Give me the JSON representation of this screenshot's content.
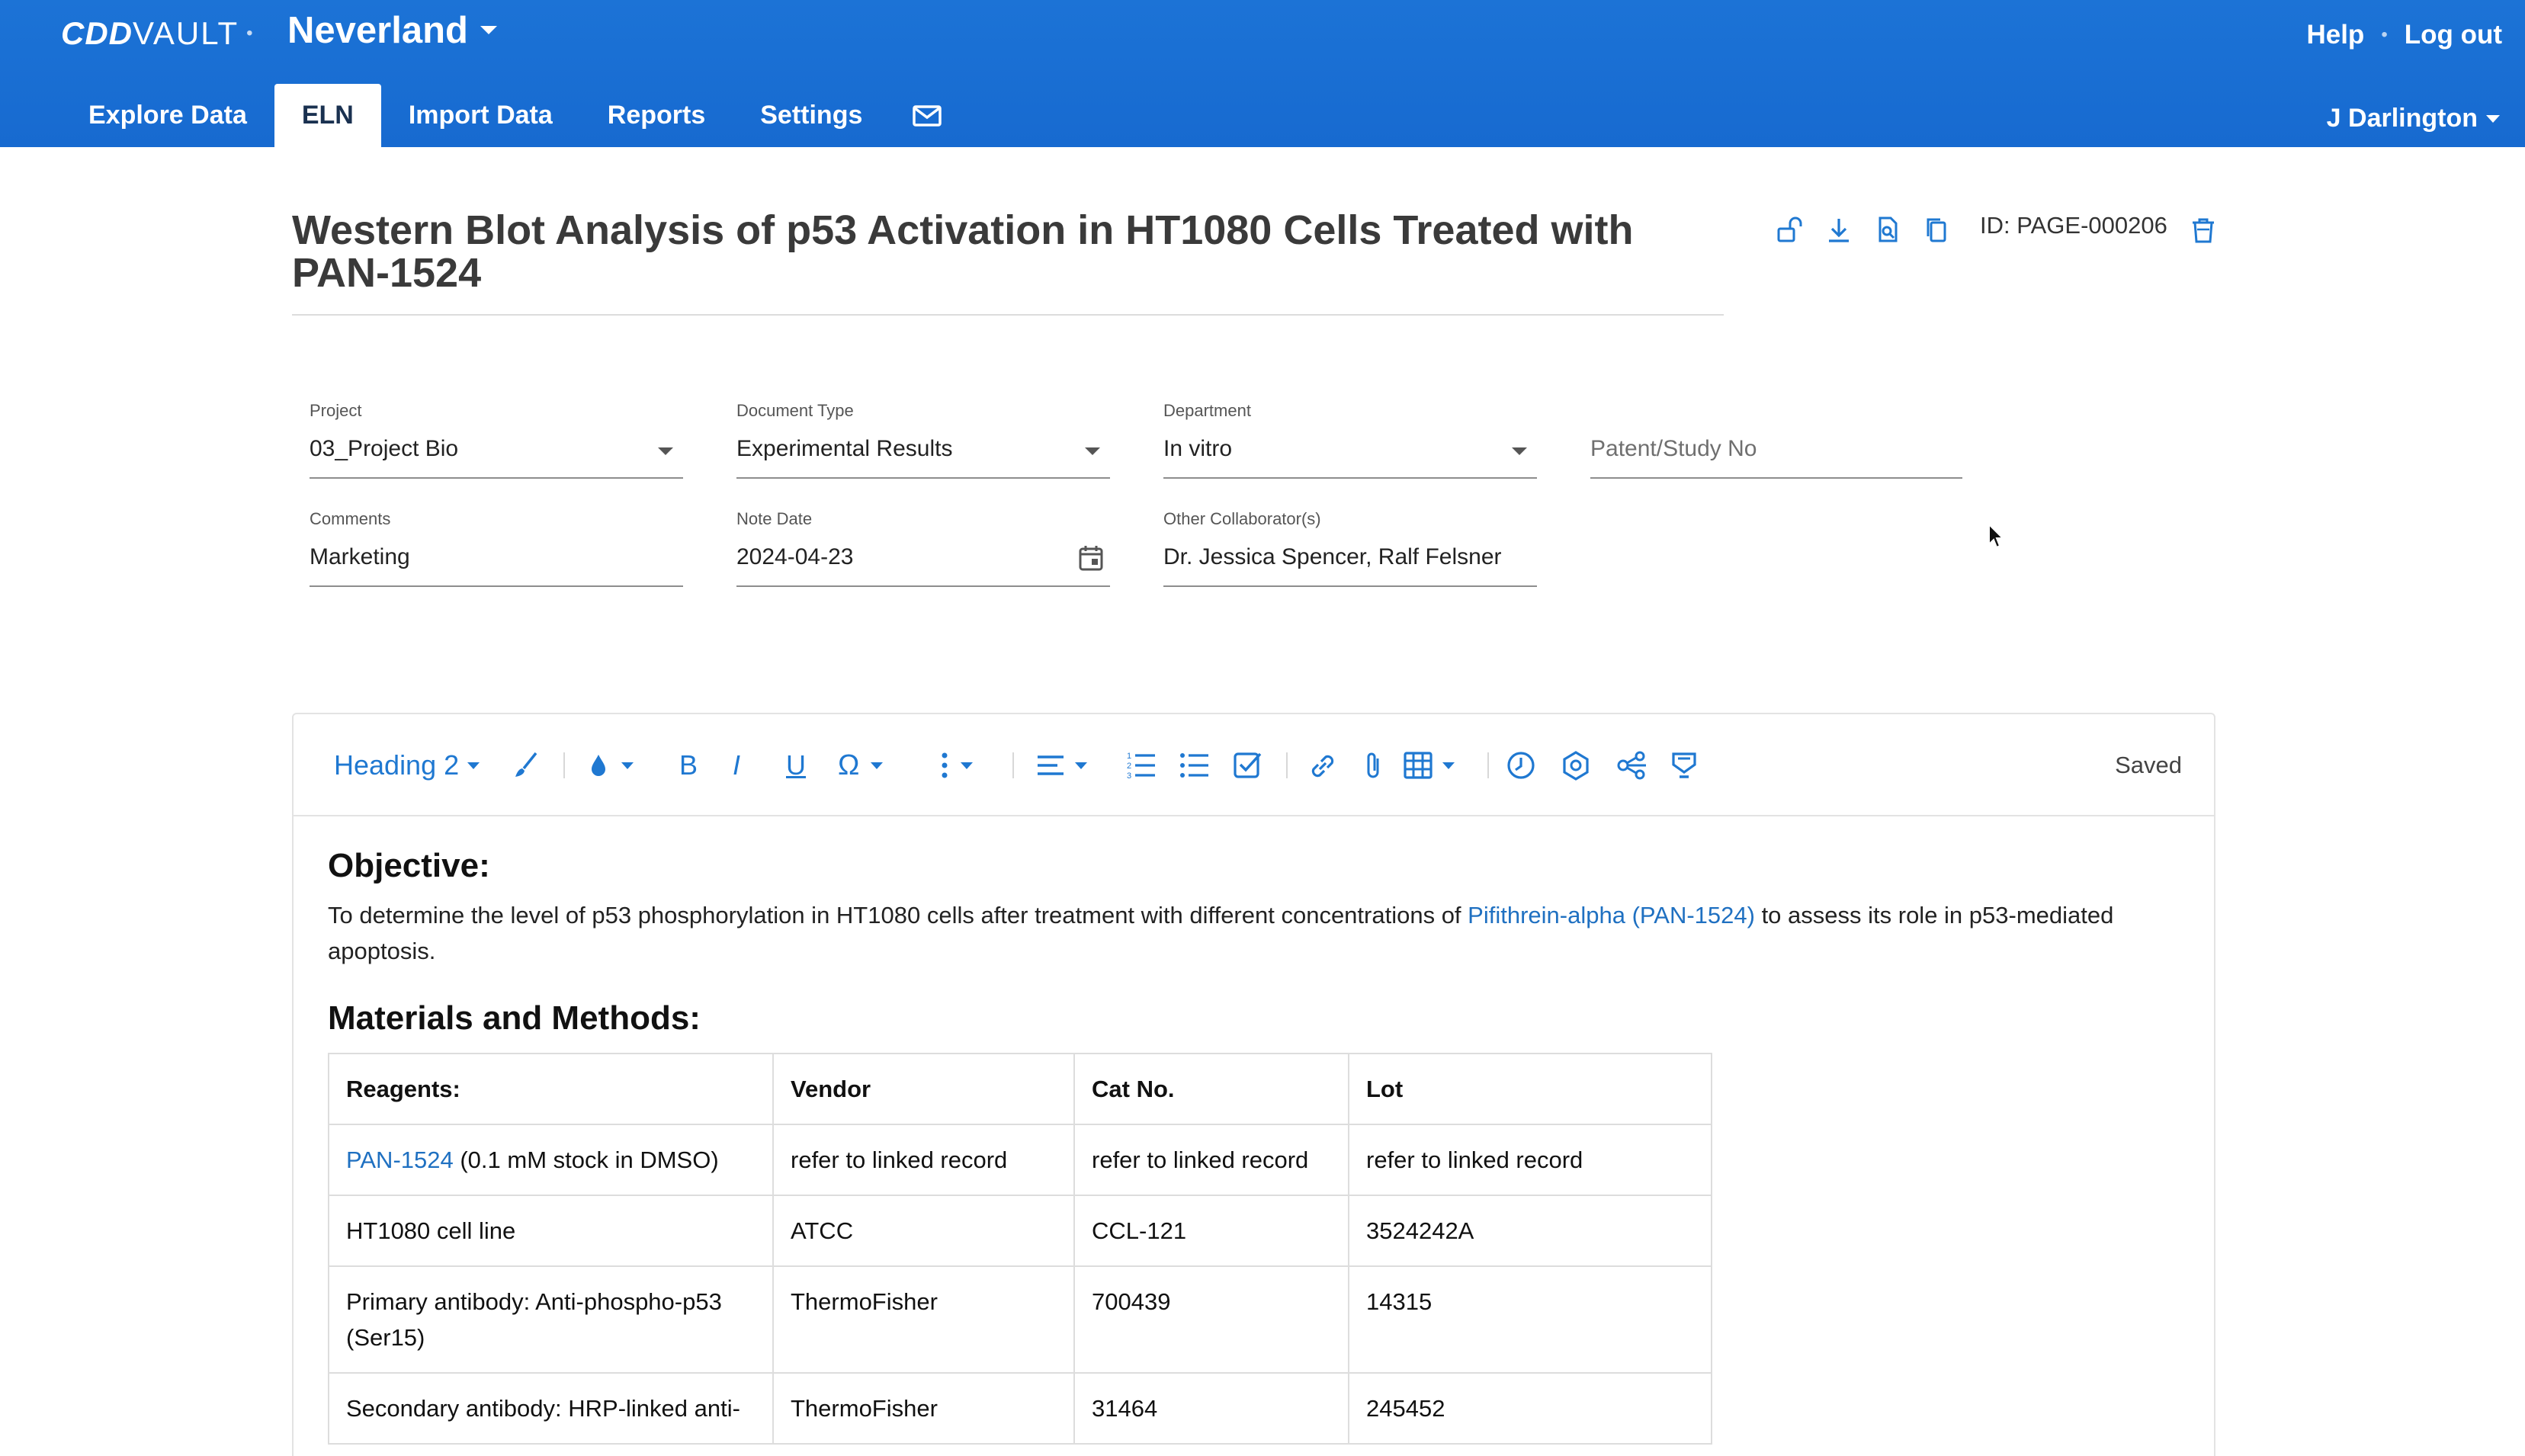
{
  "header": {
    "logo_cdd": "CDD",
    "logo_vault": "VAULT",
    "logo_dot": "•",
    "vault_name": "Neverland",
    "help_label": "Help",
    "separator": "•",
    "logout_label": "Log out",
    "user_name": "J Darlington"
  },
  "nav": {
    "tabs": [
      {
        "label": "Explore Data",
        "active": false
      },
      {
        "label": "ELN",
        "active": true
      },
      {
        "label": "Import Data",
        "active": false
      },
      {
        "label": "Reports",
        "active": false
      },
      {
        "label": "Settings",
        "active": false
      }
    ],
    "mail_icon": "envelope-icon"
  },
  "document": {
    "title": "Western Blot Analysis of p53 Activation in HT1080 Cells Treated with PAN-1524",
    "id_label": "ID: PAGE-000206",
    "action_icons": [
      "unlock-icon",
      "download-icon",
      "search-document-icon",
      "copy-icon",
      "trash-icon"
    ]
  },
  "fields": {
    "project": {
      "label": "Project",
      "value": "03_Project Bio"
    },
    "document_type": {
      "label": "Document Type",
      "value": "Experimental Results"
    },
    "department": {
      "label": "Department",
      "value": "In vitro"
    },
    "patent": {
      "placeholder": "Patent/Study No"
    },
    "comments": {
      "label": "Comments",
      "value": "Marketing"
    },
    "note_date": {
      "label": "Note Date",
      "value": "2024-04-23"
    },
    "collaborators": {
      "label": "Other Collaborator(s)",
      "value": "Dr. Jessica Spencer, Ralf Felsner"
    }
  },
  "editor": {
    "style_select": "Heading 2",
    "status": "Saved",
    "toolbar_icons": [
      "brush-icon",
      "text-color-icon",
      "bold-icon",
      "italic-icon",
      "underline-icon",
      "special-char-icon",
      "more-vertical-icon",
      "align-icon",
      "ordered-list-icon",
      "bullet-list-icon",
      "checklist-icon",
      "link-icon",
      "attachment-icon",
      "table-icon",
      "clock-icon",
      "molecule-icon",
      "share-graph-icon",
      "stamp-icon"
    ],
    "toolbar_glyphs": {
      "bold": "B",
      "italic": "I",
      "underline": "U",
      "omega": "Ω"
    },
    "objective": {
      "heading": "Objective:",
      "text_before": "To determine the level of p53 phosphorylation in HT1080 cells after treatment with different concentrations of ",
      "link": "Pifithrein-alpha (PAN-1524)",
      "text_after": " to assess its role in p53-mediated apoptosis."
    },
    "methods_heading": "Materials and Methods:",
    "table": {
      "headers": [
        "Reagents:",
        "Vendor",
        "Cat No.",
        "Lot"
      ],
      "rows": [
        {
          "link": "PAN-1524",
          "reagent": " (0.1 mM stock in DMSO)",
          "vendor": "refer to linked record",
          "cat": "refer to linked record",
          "lot": "refer to linked record"
        },
        {
          "reagent": "HT1080 cell line",
          "vendor": "ATCC",
          "cat": "CCL-121",
          "lot": "3524242A"
        },
        {
          "reagent": "Primary antibody: Anti-phospho-p53 (Ser15)",
          "vendor": "ThermoFisher",
          "cat": "700439",
          "lot": "14315"
        },
        {
          "reagent": "Secondary antibody: HRP-linked anti-",
          "vendor": "ThermoFisher",
          "cat": "31464",
          "lot": "245452"
        }
      ]
    }
  }
}
